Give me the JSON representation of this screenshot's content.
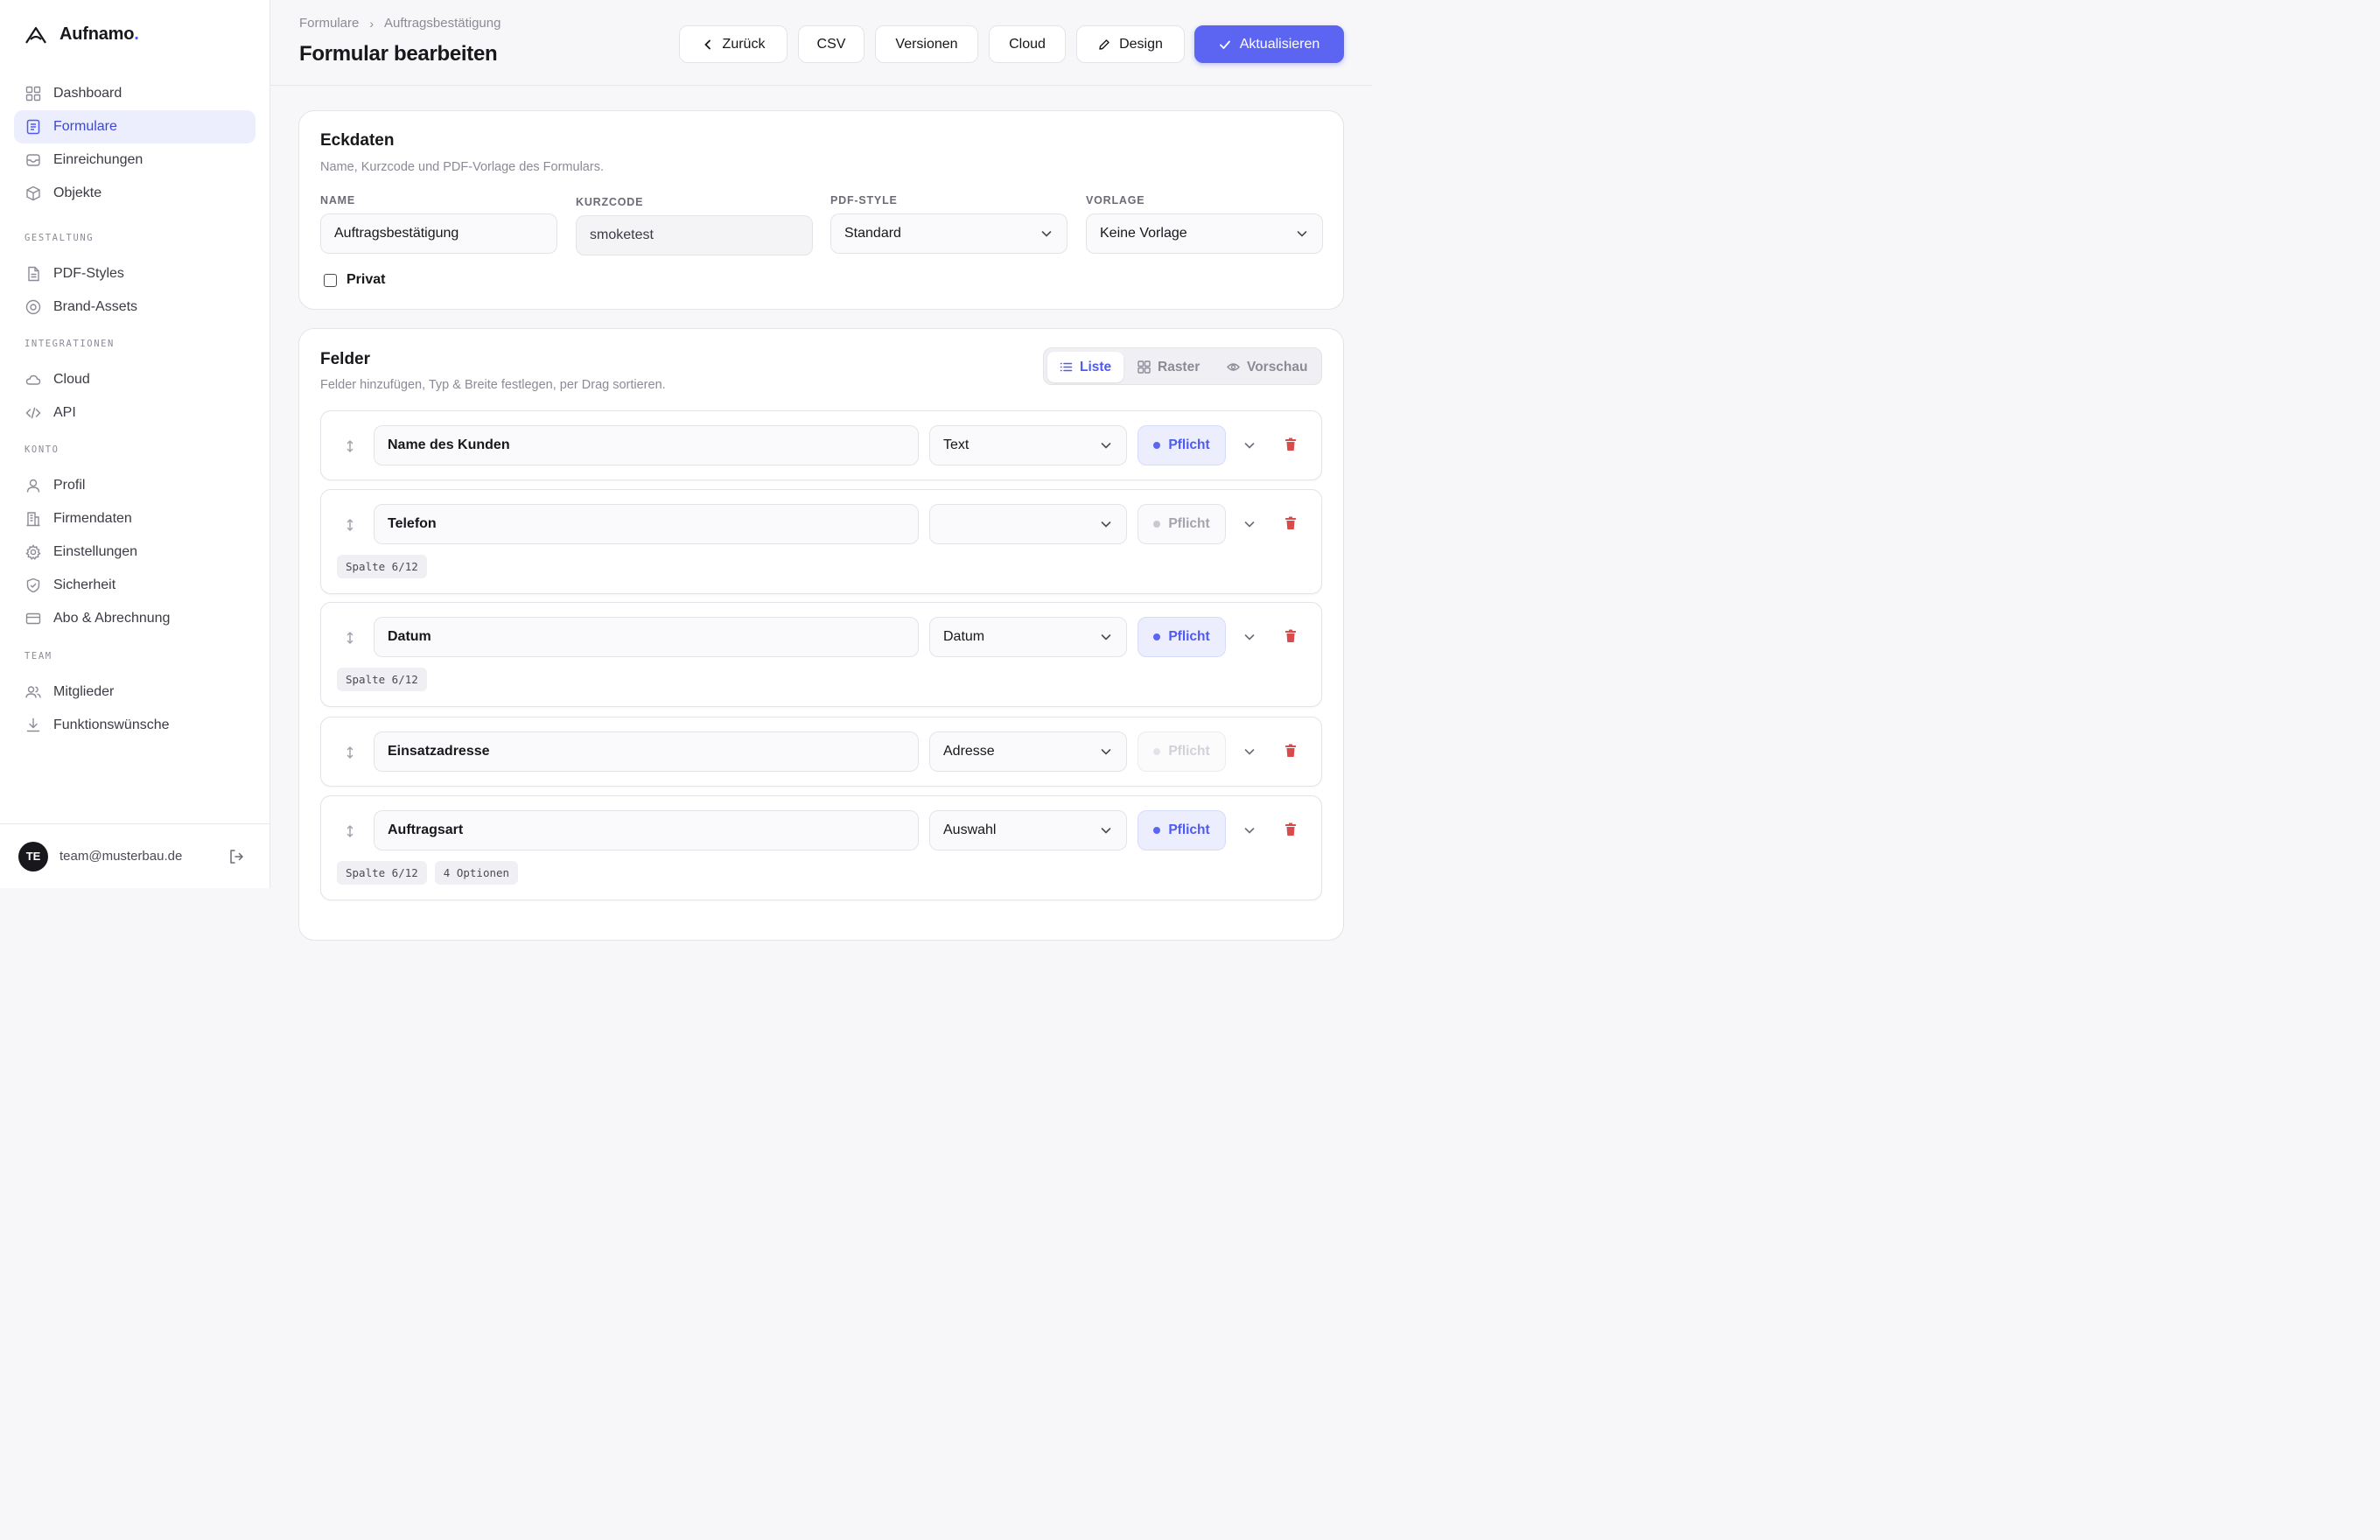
{
  "brand": {
    "name": "Aufnamo",
    "dot": "."
  },
  "sidebar": {
    "main": [
      {
        "label": "Dashboard",
        "icon": "dashboard-icon"
      },
      {
        "label": "Formulare",
        "icon": "form-icon",
        "active": true
      },
      {
        "label": "Einreichungen",
        "icon": "inbox-icon"
      },
      {
        "label": "Objekte",
        "icon": "cube-icon"
      }
    ],
    "sections": [
      {
        "title": "GESTALTUNG",
        "items": [
          {
            "label": "PDF-Styles",
            "icon": "file-icon"
          },
          {
            "label": "Brand-Assets",
            "icon": "target-icon"
          }
        ]
      },
      {
        "title": "INTEGRATIONEN",
        "items": [
          {
            "label": "Cloud",
            "icon": "cloud-icon"
          },
          {
            "label": "API",
            "icon": "code-icon"
          }
        ]
      },
      {
        "title": "KONTO",
        "items": [
          {
            "label": "Profil",
            "icon": "user-icon"
          },
          {
            "label": "Firmendaten",
            "icon": "building-icon"
          },
          {
            "label": "Einstellungen",
            "icon": "gear-icon"
          },
          {
            "label": "Sicherheit",
            "icon": "shield-icon"
          },
          {
            "label": "Abo & Abrechnung",
            "icon": "card-icon"
          }
        ]
      },
      {
        "title": "TEAM",
        "items": [
          {
            "label": "Mitglieder",
            "icon": "users-icon"
          },
          {
            "label": "Funktionswünsche",
            "icon": "download-icon"
          }
        ]
      }
    ],
    "user": {
      "initials": "TE",
      "email": "team@musterbau.de"
    }
  },
  "header": {
    "breadcrumb": [
      "Formulare",
      "Auftragsbestätigung"
    ],
    "breadcrumb_sep": "›",
    "title": "Formular bearbeiten",
    "buttons": {
      "back": "Zurück",
      "csv": "CSV",
      "versions": "Versionen",
      "cloud": "Cloud",
      "design": "Design",
      "update": "Aktualisieren"
    }
  },
  "eckdaten": {
    "title": "Eckdaten",
    "subtitle": "Name, Kurzcode und PDF-Vorlage des Formulars.",
    "labels": {
      "name": "NAME",
      "kurzcode": "KURZCODE",
      "pdf_style": "PDF-STYLE",
      "vorlage": "VORLAGE"
    },
    "values": {
      "name": "Auftragsbestätigung",
      "kurzcode": "smoketest",
      "pdf_style": "Standard",
      "vorlage": "Keine Vorlage"
    },
    "privat_label": "Privat",
    "privat_checked": false
  },
  "felder": {
    "title": "Felder",
    "subtitle": "Felder hinzufügen, Typ & Breite festlegen, per Drag sortieren.",
    "views": {
      "list": "Liste",
      "grid": "Raster",
      "preview": "Vorschau"
    },
    "active_view": "Liste",
    "pflicht_label": "Pflicht",
    "rows": [
      {
        "name": "Name des Kunden",
        "type": "Text",
        "pflicht": "on",
        "tags": []
      },
      {
        "name": "Telefon",
        "type": "",
        "pflicht": "off",
        "tags": [
          "Spalte 6/12"
        ]
      },
      {
        "name": "Datum",
        "type": "Datum",
        "pflicht": "on",
        "tags": [
          "Spalte 6/12"
        ]
      },
      {
        "name": "Einsatzadresse",
        "type": "Adresse",
        "pflicht": "faint",
        "tags": []
      },
      {
        "name": "Auftragsart",
        "type": "Auswahl",
        "pflicht": "on",
        "tags": [
          "Spalte 6/12",
          "4 Optionen"
        ]
      }
    ]
  },
  "colors": {
    "accent": "#5b65f2",
    "danger": "#d94b4b",
    "active_bg": "#eceefe"
  }
}
